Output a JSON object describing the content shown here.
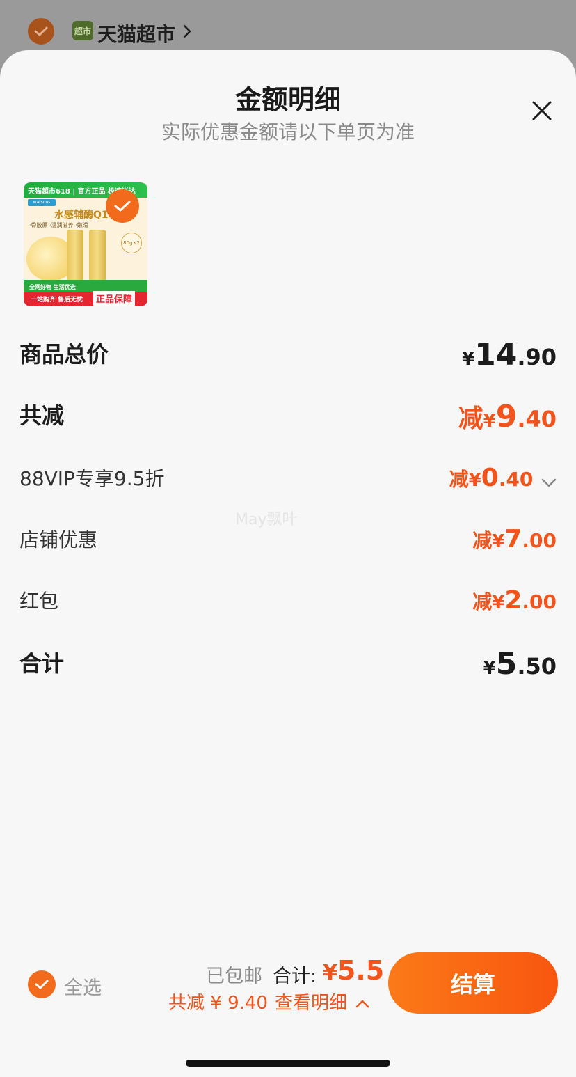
{
  "background_header": {
    "store_icon_text": "超市",
    "store_name": "天猫超市"
  },
  "sheet": {
    "title": "金额明细",
    "subtitle": "实际优惠金额请以下单页为准"
  },
  "product_thumbnail": {
    "banner_text": "天猫超市618 | 官方正品 极速送达",
    "brand_text": "watsons",
    "headline": "水感辅酶Q10",
    "tags": "·骨胶原 ·温润滋养 ·嫩滑",
    "size_badge": "80g×2",
    "promo_line": "全网好物 生活优选",
    "red_left": "一站购齐 售后无忧",
    "red_right": "正品保障"
  },
  "rows": {
    "subtotal": {
      "label": "商品总价",
      "yen": "¥",
      "int": "14",
      "dec": ".90"
    },
    "total_discount": {
      "label": "共减",
      "prefix": "减",
      "yen": "¥",
      "int": "9",
      "dec": ".40"
    },
    "vip": {
      "label": "88VIP专享9.5折",
      "prefix": "减",
      "yen": "¥",
      "int": "0",
      "dec": ".40"
    },
    "store": {
      "label": "店铺优惠",
      "prefix": "减",
      "yen": "¥",
      "int": "7",
      "dec": ".00"
    },
    "red_packet": {
      "label": "红包",
      "prefix": "减",
      "yen": "¥",
      "int": "2",
      "dec": ".00"
    },
    "total": {
      "label": "合计",
      "yen": "¥",
      "int": "5",
      "dec": ".50"
    }
  },
  "watermark": "May飘叶",
  "bottom_bar": {
    "select_all": "全选",
    "shipping": "已包邮",
    "total_label": "合计:",
    "total_yen": "¥",
    "total_amount": "5.5",
    "saved_text": "共减 ¥ 9.40",
    "detail_link": "查看明细",
    "checkout": "结算"
  },
  "colors": {
    "accent": "#f2541b",
    "button_start": "#fb7a18",
    "button_end": "#f8560f",
    "sheet_bg": "#f7f7f7"
  },
  "icons": [
    "check-icon",
    "chevron-right-icon",
    "close-icon",
    "chevron-down-icon",
    "chevron-up-icon"
  ]
}
